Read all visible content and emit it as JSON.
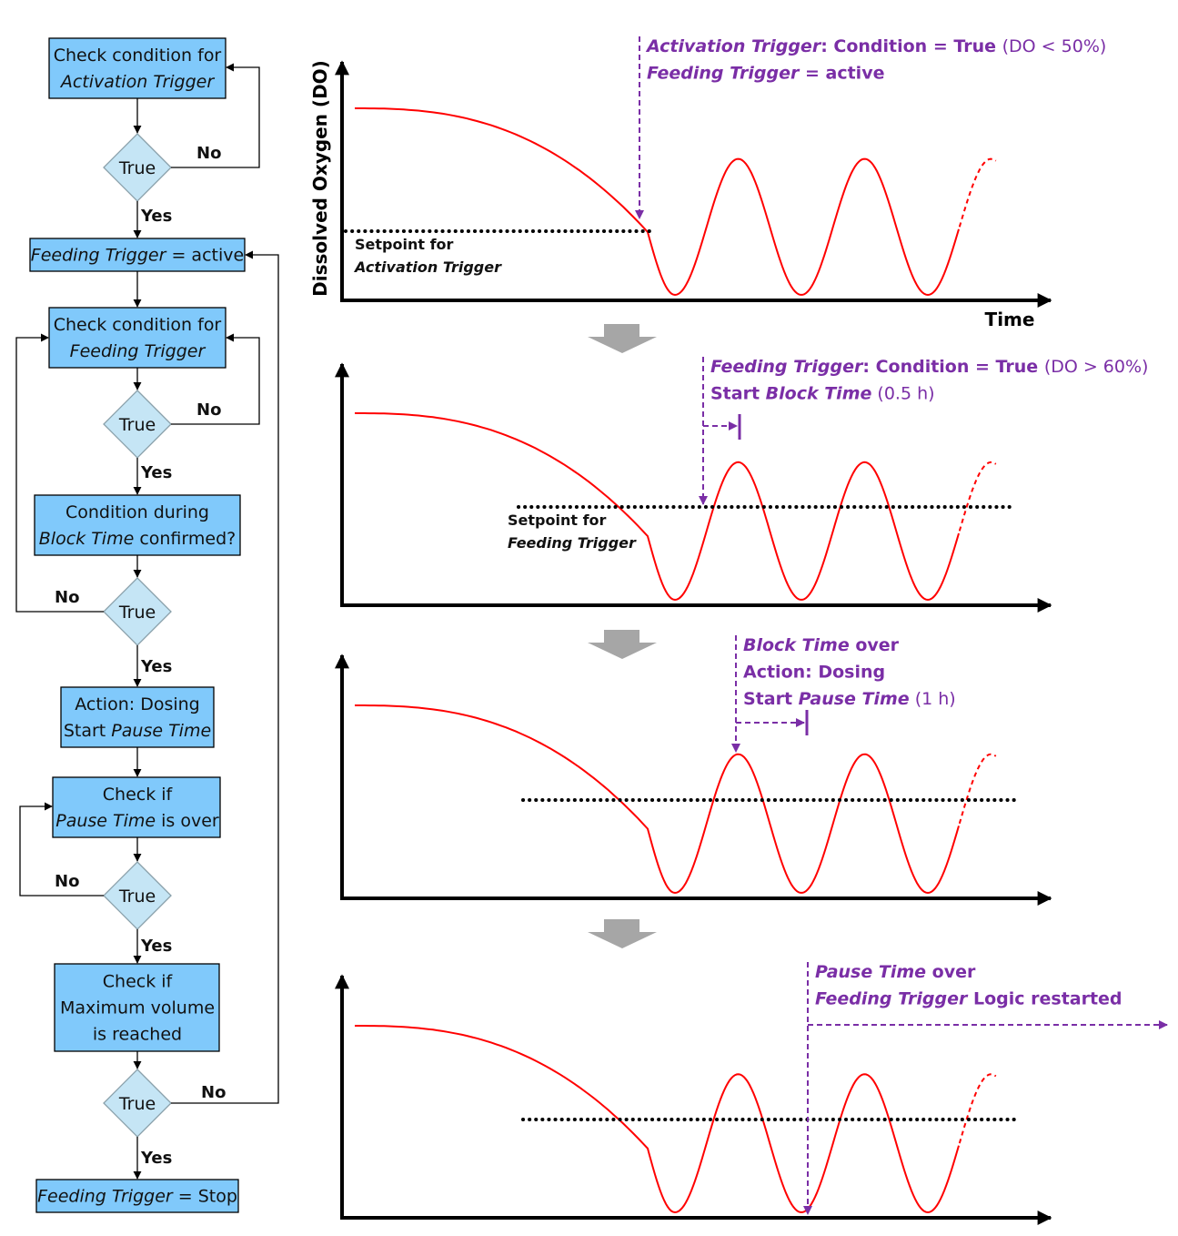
{
  "flowchart": {
    "nodes": [
      {
        "id": "check-activation",
        "type": "process",
        "lines": [
          [
            {
              "t": "Check condition for",
              "i": false
            }
          ],
          [
            {
              "t": "Activation Trigger",
              "i": true
            }
          ]
        ]
      },
      {
        "id": "decision-1",
        "type": "decision",
        "label": "True"
      },
      {
        "id": "feeding-active",
        "type": "process",
        "lines": [
          [
            {
              "t": "Feeding Trigger",
              "i": true
            },
            {
              "t": " = active",
              "i": false
            }
          ]
        ]
      },
      {
        "id": "check-feeding",
        "type": "process",
        "lines": [
          [
            {
              "t": "Check condition for",
              "i": false
            }
          ],
          [
            {
              "t": "Feeding Trigger",
              "i": true
            }
          ]
        ]
      },
      {
        "id": "decision-2",
        "type": "decision",
        "label": "True"
      },
      {
        "id": "block-time",
        "type": "process",
        "lines": [
          [
            {
              "t": "Condition during",
              "i": false
            }
          ],
          [
            {
              "t": "Block Time",
              "i": true
            },
            {
              "t": " confirmed?",
              "i": false
            }
          ]
        ]
      },
      {
        "id": "decision-3",
        "type": "decision",
        "label": "True"
      },
      {
        "id": "dosing",
        "type": "process",
        "lines": [
          [
            {
              "t": "Action: Dosing",
              "i": false
            }
          ],
          [
            {
              "t": "Start ",
              "i": false
            },
            {
              "t": "Pause Time",
              "i": true
            }
          ]
        ]
      },
      {
        "id": "check-pause",
        "type": "process",
        "lines": [
          [
            {
              "t": "Check if",
              "i": false
            }
          ],
          [
            {
              "t": "Pause Time",
              "i": true
            },
            {
              "t": " is over",
              "i": false
            }
          ]
        ]
      },
      {
        "id": "decision-4",
        "type": "decision",
        "label": "True"
      },
      {
        "id": "check-volume",
        "type": "process",
        "lines": [
          [
            {
              "t": "Check if",
              "i": false
            }
          ],
          [
            {
              "t": "Maximum volume",
              "i": false
            }
          ],
          [
            {
              "t": "is reached",
              "i": false
            }
          ]
        ]
      },
      {
        "id": "decision-5",
        "type": "decision",
        "label": "True"
      },
      {
        "id": "feeding-stop",
        "type": "process",
        "lines": [
          [
            {
              "t": "Feeding Trigger",
              "i": true
            },
            {
              "t": " = Stop",
              "i": false
            }
          ]
        ]
      }
    ],
    "yes_label": "Yes",
    "no_label": "No"
  },
  "colors": {
    "box_fill": "#80c9fb",
    "decision_fill": "#c5e5f5",
    "decision_stroke": "#8aa0aa",
    "curve": "#ff0000",
    "annotation": "#7a2ea6",
    "step_arrow": "#a6a6a6",
    "axis": "#000000"
  },
  "chart_data": [
    {
      "type": "line",
      "title": "",
      "ylabel": "Dissolved Oxygen (DO)",
      "xlabel": "Time",
      "series": [
        {
          "name": "DO",
          "shape": "exponential decline then sinusoidal oscillation (3 full cycles, last dashed)"
        }
      ],
      "setpoint": {
        "label_lines": [
          [
            {
              "t": "Setpoint for",
              "i": false
            }
          ],
          [
            {
              "t": "Activation Trigger",
              "i": true
            }
          ]
        ],
        "level_fraction": 0.28
      },
      "annotation": {
        "lines": [
          [
            {
              "t": "Activation Trigger",
              "i": true,
              "b": true
            },
            {
              "t": ": Condition = True ",
              "i": false,
              "b": true
            },
            {
              "t": "(DO < 50%)",
              "i": false,
              "b": false
            }
          ],
          [
            {
              "t": "Feeding Trigger",
              "i": true,
              "b": true
            },
            {
              "t": " = active",
              "i": false,
              "b": true
            }
          ]
        ]
      }
    },
    {
      "type": "line",
      "series": [
        {
          "name": "DO"
        }
      ],
      "setpoint": {
        "label_lines": [
          [
            {
              "t": "Setpoint for",
              "i": false
            }
          ],
          [
            {
              "t": "Feeding Trigger",
              "i": true
            }
          ]
        ],
        "level_fraction": 0.38
      },
      "annotation": {
        "lines": [
          [
            {
              "t": "Feeding Trigger",
              "i": true,
              "b": true
            },
            {
              "t": ": Condition = True ",
              "i": false,
              "b": true
            },
            {
              "t": "(DO > 60%)",
              "i": false,
              "b": false
            }
          ],
          [
            {
              "t": "Start ",
              "i": false,
              "b": true
            },
            {
              "t": "Block Time",
              "i": true,
              "b": true
            },
            {
              "t": " (0.5 h)",
              "i": false,
              "b": false
            }
          ]
        ]
      }
    },
    {
      "type": "line",
      "series": [
        {
          "name": "DO"
        }
      ],
      "setpoint": {
        "label_lines": [],
        "level_fraction": 0.38
      },
      "annotation": {
        "lines": [
          [
            {
              "t": "Block Time",
              "i": true,
              "b": true
            },
            {
              "t": " over",
              "i": false,
              "b": true
            }
          ],
          [
            {
              "t": "Action: Dosing",
              "i": false,
              "b": true
            }
          ],
          [
            {
              "t": "Start ",
              "i": false,
              "b": true
            },
            {
              "t": "Pause Time",
              "i": true,
              "b": true
            },
            {
              "t": " (1 h)",
              "i": false,
              "b": false
            }
          ]
        ]
      }
    },
    {
      "type": "line",
      "series": [
        {
          "name": "DO"
        }
      ],
      "setpoint": {
        "label_lines": [],
        "level_fraction": 0.38
      },
      "annotation": {
        "lines": [
          [
            {
              "t": "Pause Time",
              "i": true,
              "b": true
            },
            {
              "t": " over",
              "i": false,
              "b": true
            }
          ],
          [
            {
              "t": "Feeding Trigger",
              "i": true,
              "b": true
            },
            {
              "t": " Logic restarted",
              "i": false,
              "b": true
            }
          ]
        ]
      }
    }
  ]
}
